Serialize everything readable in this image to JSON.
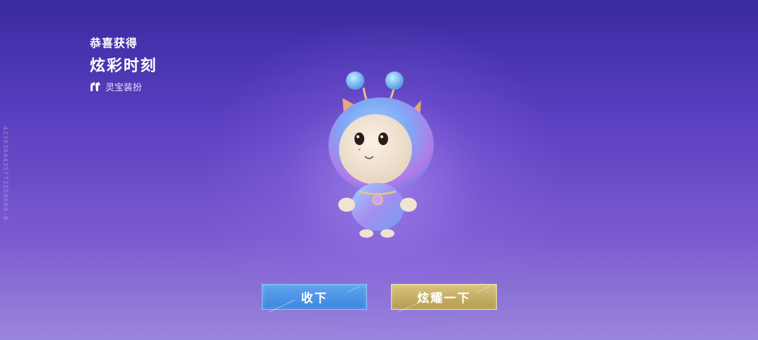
{
  "header": {
    "congrats_label": "恭喜获得",
    "item_name": "炫彩时刻",
    "item_category": "灵宝装扮"
  },
  "side_id": "4230304435773559669-8",
  "buttons": {
    "accept_label": "收下",
    "show_off_label": "炫耀一下"
  },
  "colors": {
    "accept_button": "#4a94e6",
    "show_off_button": "#c9b265",
    "background_top": "#3a2aa0",
    "background_bottom": "#9a86dc"
  },
  "icons": {
    "category": "costume-icon"
  }
}
